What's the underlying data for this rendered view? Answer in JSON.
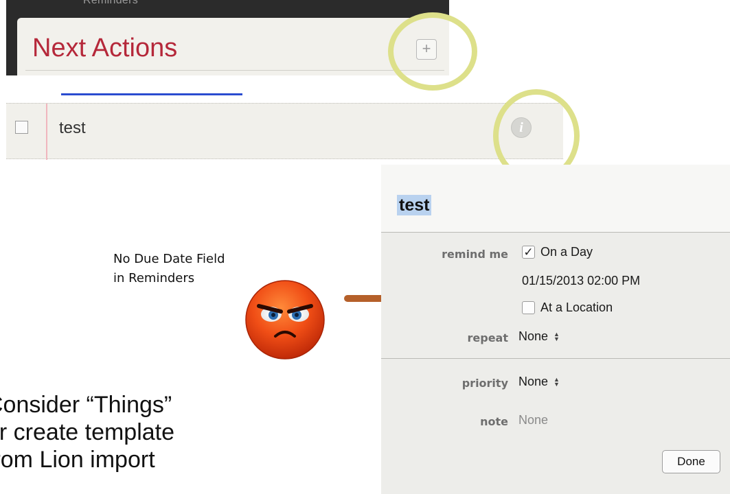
{
  "list_header": {
    "window_title": "Reminders",
    "list_title": "Next Actions",
    "add_button_symbol": "+"
  },
  "reminder_row": {
    "text": "test",
    "info_symbol": "i"
  },
  "details": {
    "title": "test",
    "remind_me_label": "remind me",
    "on_a_day_label": "On a Day",
    "on_a_day_checked": true,
    "datetime": "01/15/2013  02:00 PM",
    "at_location_label": "At a Location",
    "at_location_checked": false,
    "repeat_label": "repeat",
    "repeat_value": "None",
    "priority_label": "priority",
    "priority_value": "None",
    "note_label": "note",
    "note_value": "None",
    "done_label": "Done",
    "stepper_symbol": "▲▼"
  },
  "annotation": {
    "line1": "No Due Date Field",
    "line2": "in Reminders"
  },
  "slide_text": {
    "line1": "Consider “Things”",
    "line2": "or create template",
    "line3": "from Lion import"
  },
  "colors": {
    "list_title": "#b5283a",
    "highlight_ring": "#dde08a",
    "arrow": "#b5602a",
    "face": "#e63a14"
  }
}
